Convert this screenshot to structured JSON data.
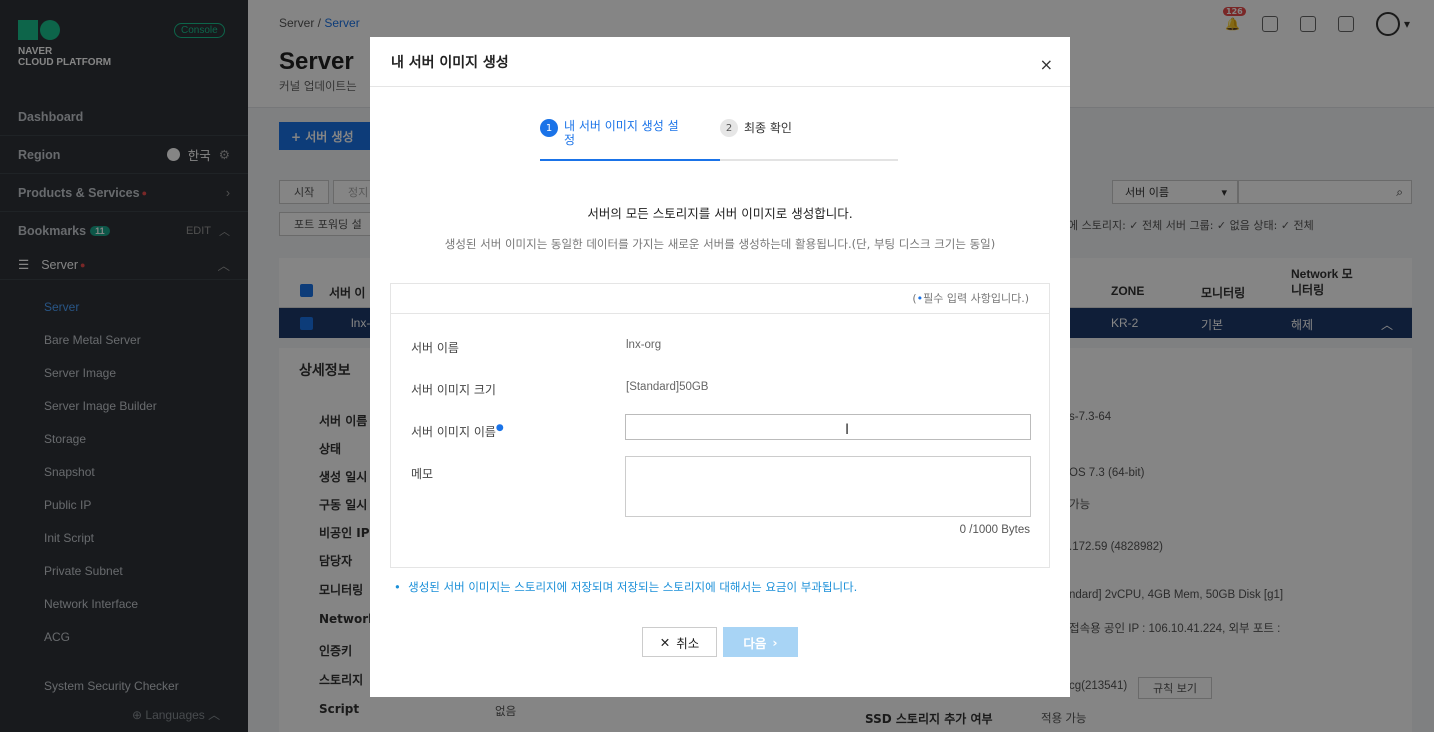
{
  "sidebar": {
    "brand_line1": "NAVER",
    "brand_line2": "CLOUD PLATFORM",
    "console_label": "Console",
    "dashboard": "Dashboard",
    "region_label": "Region",
    "region_value": "한국",
    "products_label": "Products & Services",
    "bookmarks_label": "Bookmarks",
    "bookmarks_count": "11",
    "bookmarks_edit": "EDIT",
    "server_group": "Server",
    "sub_items": [
      "Server",
      "Bare Metal Server",
      "Server Image",
      "Server Image Builder",
      "Storage",
      "Snapshot",
      "Public IP",
      "Init Script",
      "Private Subnet",
      "Network Interface",
      "ACG"
    ],
    "security_checker": "System Security Checker",
    "languages": "Languages"
  },
  "header": {
    "crumb_root": "Server /",
    "crumb_current": "Server",
    "notif_count": "126",
    "page_title": "Server",
    "page_desc": "커널 업데이트는"
  },
  "toolbar": {
    "create_label": "+ 서버 생성",
    "start_label": "시작",
    "stop_label": "정지",
    "port_label": "포트 포워딩 설",
    "search_select": "서버 이름",
    "filter_text": "에  스토리지: ✓ 전체  서버 그룹: ✓ 없음  상태: ✓ 전체"
  },
  "table": {
    "col_name": "서버 이",
    "col_zone": "ZONE",
    "col_monitor": "모니터링",
    "col_network": "Network 모니터링",
    "row_name": "lnx-",
    "row_zone": "KR-2",
    "row_monitor": "기본",
    "row_network": "해제"
  },
  "detail": {
    "title": "상세정보",
    "labels": [
      "서버 이름",
      "상태",
      "생성 일시",
      "구동 일시",
      "비공인 IP",
      "담당자",
      "모니터링",
      "Network",
      "인증키",
      "스토리지",
      "Script"
    ],
    "script_value": "없음",
    "right_values": [
      "s-7.3-64",
      "OS 7.3 (64-bit)",
      "가능",
      ".172.59 (4828982)",
      "ndard] 2vCPU, 4GB Mem, 50GB Disk [g1]",
      "접속용 공인 IP : 106.10.41.224, 외부 포트 :",
      "cg(213541)"
    ],
    "rule_button": "규칙 보기",
    "ssd_label": "SSD 스토리지 추가 여부",
    "ssd_value": "적용 가능"
  },
  "modal": {
    "title": "내 서버 이미지 생성",
    "close_icon": "×",
    "step1_num": "1",
    "step1_label": "내 서버 이미지 생성 설정",
    "step2_num": "2",
    "step2_label": "최종 확인",
    "msg_main": "서버의 모든 스토리지를 서버 이미지로 생성합니다.",
    "msg_sub": "생성된 서버 이미지는 동일한 데이터를 가지는 새로운 서버를 생성하는데 활용됩니다.(단, 부팅 디스크 크기는 동일)",
    "required_note": "필수 입력 사항입니다.)",
    "server_name_label": "서버 이름",
    "server_name_value": "lnx-org",
    "image_size_label": "서버 이미지 크기",
    "image_size_value": "[Standard]50GB",
    "image_name_label": "서버 이미지 이름",
    "image_name_value": "",
    "memo_label": "메모",
    "memo_value": "",
    "counter": "0 /1000 Bytes",
    "footnote": "생성된 서버 이미지는 스토리지에 저장되며 저장되는 스토리지에 대해서는 요금이 부과됩니다.",
    "cancel_label": "취소",
    "next_label": "다음"
  },
  "colors": {
    "accent": "#1a73e8",
    "brand": "#19c28e",
    "sidebar": "#2e3339",
    "selected_row": "#1e3a6b"
  }
}
